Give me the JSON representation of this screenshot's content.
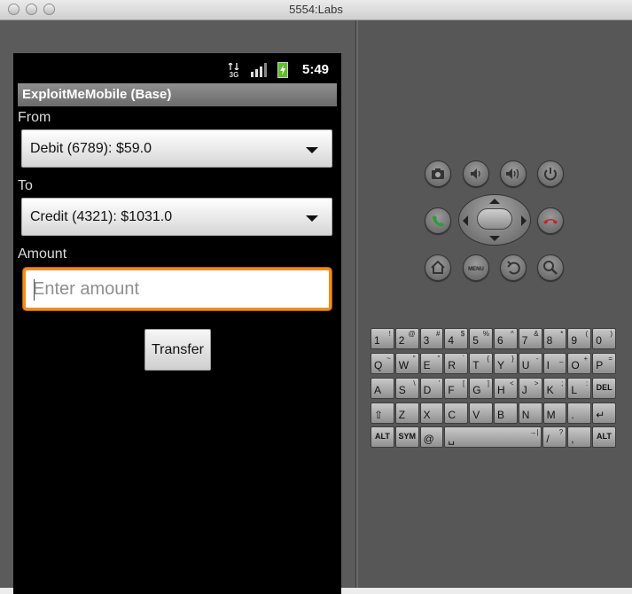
{
  "window": {
    "title": "5554:Labs"
  },
  "status_bar": {
    "network": "3G",
    "time": "5:49"
  },
  "app": {
    "title": "ExploitMeMobile (Base)",
    "from_label": "From",
    "from_value": "Debit (6789): $59.0",
    "to_label": "To",
    "to_value": "Credit (4321): $1031.0",
    "amount_label": "Amount",
    "amount_placeholder": "Enter amount",
    "amount_value": "",
    "transfer_label": "Transfer"
  },
  "controls": {
    "menu_label": "MENU"
  },
  "keyboard": {
    "rows": [
      [
        {
          "m": "1",
          "s": "!"
        },
        {
          "m": "2",
          "s": "@"
        },
        {
          "m": "3",
          "s": "#"
        },
        {
          "m": "4",
          "s": "$"
        },
        {
          "m": "5",
          "s": "%"
        },
        {
          "m": "6",
          "s": "^"
        },
        {
          "m": "7",
          "s": "&"
        },
        {
          "m": "8",
          "s": "*"
        },
        {
          "m": "9",
          "s": "("
        },
        {
          "m": "0",
          "s": ")"
        }
      ],
      [
        {
          "m": "Q",
          "s": "~"
        },
        {
          "m": "W",
          "s": "\""
        },
        {
          "m": "E",
          "s": "\""
        },
        {
          "m": "R",
          "s": "`"
        },
        {
          "m": "T",
          "s": "{"
        },
        {
          "m": "Y",
          "s": "}"
        },
        {
          "m": "U",
          "s": "-"
        },
        {
          "m": "I",
          "s": "_"
        },
        {
          "m": "O",
          "s": "+"
        },
        {
          "m": "P",
          "s": "="
        }
      ],
      [
        {
          "m": "A",
          "s": ""
        },
        {
          "m": "S",
          "s": "\\"
        },
        {
          "m": "D",
          "s": "'"
        },
        {
          "m": "F",
          "s": "["
        },
        {
          "m": "G",
          "s": "]"
        },
        {
          "m": "H",
          "s": "<"
        },
        {
          "m": "J",
          "s": ">"
        },
        {
          "m": "K",
          "s": ";"
        },
        {
          "m": "L",
          "s": ":"
        },
        {
          "m": "",
          "s": "",
          "c": "DEL"
        }
      ],
      [
        {
          "m": "⇧",
          "s": ""
        },
        {
          "m": "Z",
          "s": ""
        },
        {
          "m": "X",
          "s": ""
        },
        {
          "m": "C",
          "s": ""
        },
        {
          "m": "V",
          "s": ""
        },
        {
          "m": "B",
          "s": ""
        },
        {
          "m": "N",
          "s": ""
        },
        {
          "m": "M",
          "s": ""
        },
        {
          "m": ".",
          "s": ""
        },
        {
          "m": "↵",
          "s": ""
        }
      ],
      [
        {
          "m": "",
          "s": "",
          "c": "ALT"
        },
        {
          "m": "",
          "s": "",
          "c": "SYM"
        },
        {
          "m": "@",
          "s": ""
        },
        {
          "m": "␣",
          "s": "→|"
        },
        {
          "m": "/",
          "s": "?"
        },
        {
          "m": ",",
          "s": ""
        },
        {
          "m": "",
          "s": "",
          "c": "ALT"
        }
      ]
    ]
  }
}
